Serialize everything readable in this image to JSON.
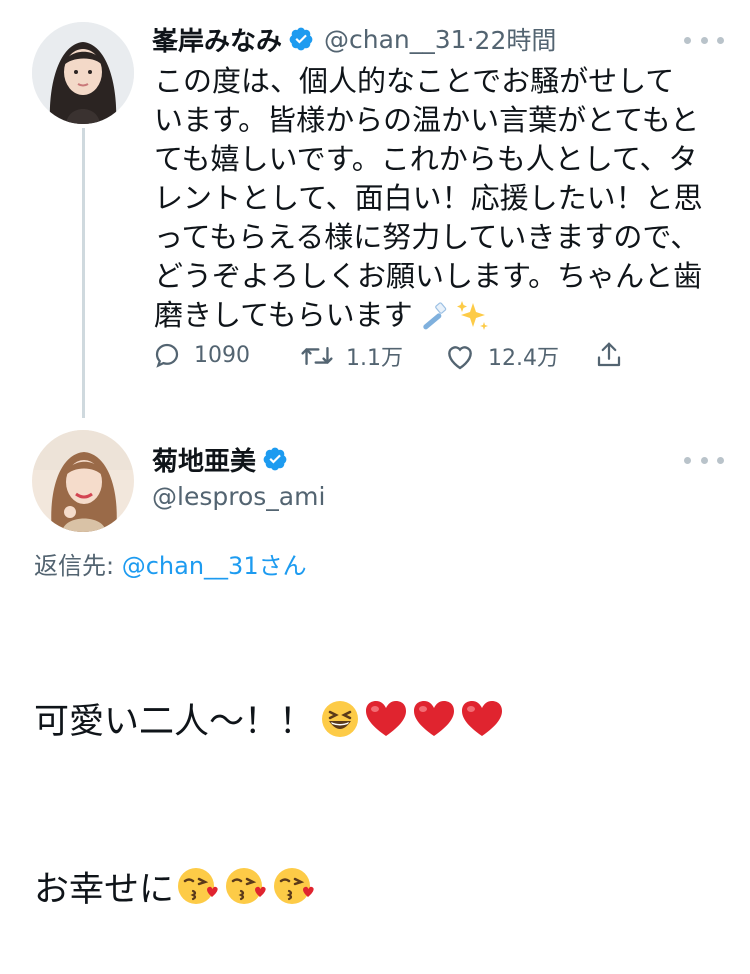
{
  "tweet": {
    "author_name": "峯岸みなみ",
    "handle": "@chan__31",
    "separator": "·",
    "time": "22時間",
    "verified": true,
    "text": "この度は、個人的なことでお騒がせして\nいます。皆様からの温かい言葉がとてもと\nても嬉しいです。これからも人として、タ\nレントとして、面白い！応援したい！と思\nってもらえる様に努力していきますので、\nどうぞよろしくお願いします。ちゃんと歯\n磨きしてもらいます",
    "trailing_emoji": [
      "toothbrush-emoji",
      "sparkles-emoji"
    ],
    "actions": {
      "replies": "1090",
      "retweets": "1.1万",
      "likes": "12.4万"
    }
  },
  "reply": {
    "author_name": "菊地亜美",
    "handle": "@lespros_ami",
    "verified": true,
    "reply_prefix": "返信先: ",
    "reply_handle": "@chan__31さん",
    "line1": "可愛い二人〜！！",
    "line1_emoji": [
      "grinning-squinting-face-emoji",
      "red-heart-emoji",
      "red-heart-emoji",
      "red-heart-emoji"
    ],
    "line2": "お幸せに",
    "line2_emoji": [
      "face-blowing-kiss-emoji",
      "face-blowing-kiss-emoji",
      "face-blowing-kiss-emoji"
    ]
  },
  "colors": {
    "verified_blue": "#1d9bf0",
    "text": "#0f1419",
    "secondary": "#536471",
    "link": "#1d9bf0"
  }
}
